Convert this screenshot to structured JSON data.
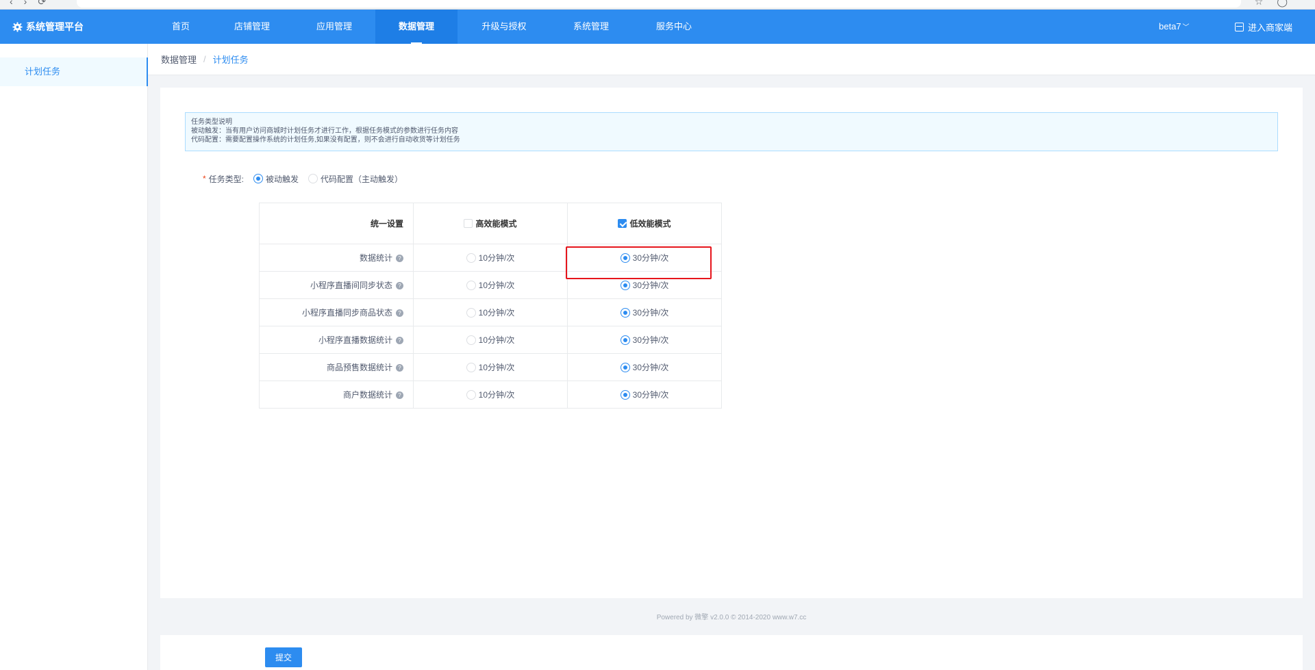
{
  "header": {
    "brand": "系统管理平台",
    "nav": [
      {
        "label": "首页",
        "active": false
      },
      {
        "label": "店铺管理",
        "active": false
      },
      {
        "label": "应用管理",
        "active": false
      },
      {
        "label": "数据管理",
        "active": true
      },
      {
        "label": "升级与授权",
        "active": false
      },
      {
        "label": "系统管理",
        "active": false
      },
      {
        "label": "服务中心",
        "active": false
      }
    ],
    "version": "beta7",
    "merchant_link": "进入商家端",
    "accent_color": "#2d8cf0"
  },
  "sidebar": {
    "items": [
      {
        "label": "计划任务",
        "active": true
      }
    ]
  },
  "breadcrumb": {
    "parent": "数据管理",
    "separator": "/",
    "current": "计划任务"
  },
  "notice": {
    "title": "任务类型说明",
    "line1": "被动触发：当有用户访问商城时计划任务才进行工作，根据任务模式的参数进行任务内容",
    "line2": "代码配置：需要配置操作系统的计划任务,如果没有配置，则不会进行自动收货等计划任务"
  },
  "form": {
    "task_type_label": "任务类型:",
    "task_type_options": [
      {
        "label": "被动触发",
        "selected": true
      },
      {
        "label": "代码配置（主动触发）",
        "selected": false
      }
    ]
  },
  "table": {
    "header": {
      "label": "统一设置",
      "high_mode": {
        "label": "高效能模式",
        "checked": false
      },
      "low_mode": {
        "label": "低效能模式",
        "checked": true
      }
    },
    "rows": [
      {
        "name": "数据统计",
        "opt_high": "10分钟/次",
        "opt_low": "30分钟/次",
        "selected": "low"
      },
      {
        "name": "小程序直播间同步状态",
        "opt_high": "10分钟/次",
        "opt_low": "30分钟/次",
        "selected": "low"
      },
      {
        "name": "小程序直播同步商品状态",
        "opt_high": "10分钟/次",
        "opt_low": "30分钟/次",
        "selected": "low"
      },
      {
        "name": "小程序直播数据统计",
        "opt_high": "10分钟/次",
        "opt_low": "30分钟/次",
        "selected": "low"
      },
      {
        "name": "商品预售数据统计",
        "opt_high": "10分钟/次",
        "opt_low": "30分钟/次",
        "selected": "low"
      },
      {
        "name": "商户数据统计",
        "opt_high": "10分钟/次",
        "opt_low": "30分钟/次",
        "selected": "low"
      }
    ]
  },
  "footer": {
    "text": "Powered by 微擎 v2.0.0 © 2014-2020 www.w7.cc"
  },
  "actions": {
    "submit_label": "提交"
  }
}
